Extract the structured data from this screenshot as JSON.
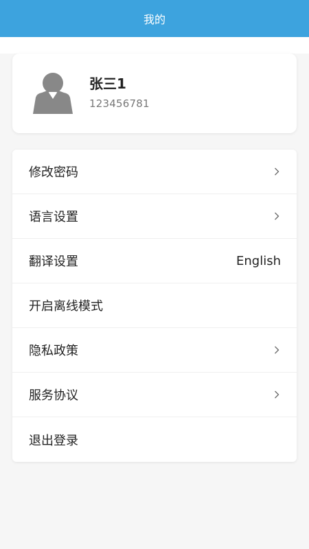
{
  "header": {
    "title": "我的",
    "background_color": "#3da3de"
  },
  "profile": {
    "name": "张三1",
    "id": "123456781",
    "avatar_icon": "user-avatar-icon"
  },
  "menu": {
    "items": [
      {
        "label": "修改密码",
        "type": "chevron",
        "icon": "chevron-right-icon"
      },
      {
        "label": "语言设置",
        "type": "chevron",
        "icon": "chevron-right-icon"
      },
      {
        "label": "翻译设置",
        "type": "value",
        "value": "English"
      },
      {
        "label": "开启离线模式",
        "type": "none"
      },
      {
        "label": "隐私政策",
        "type": "chevron",
        "icon": "chevron-right-icon"
      },
      {
        "label": "服务协议",
        "type": "chevron",
        "icon": "chevron-right-icon"
      },
      {
        "label": "退出登录",
        "type": "none"
      }
    ]
  }
}
